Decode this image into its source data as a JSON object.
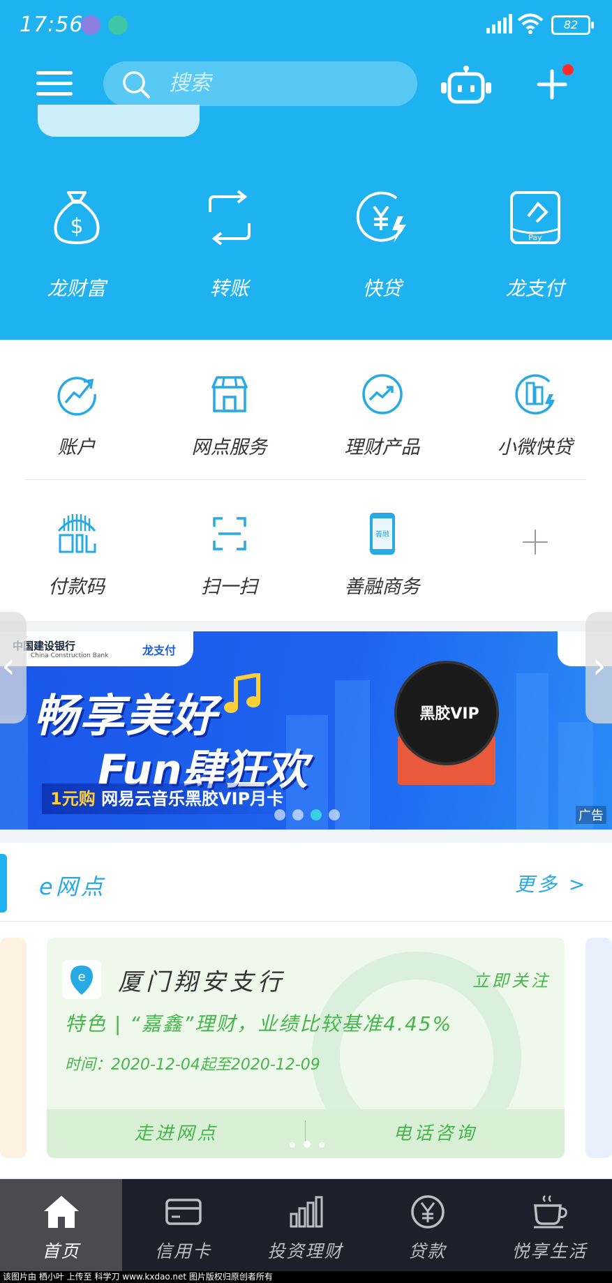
{
  "status_bar": {
    "time": "17:56",
    "battery": "82"
  },
  "header": {
    "search_placeholder": "搜索"
  },
  "quick_actions": [
    {
      "label": "龙财富",
      "icon": "money-bag-icon"
    },
    {
      "label": "转账",
      "icon": "transfer-icon"
    },
    {
      "label": "快贷",
      "icon": "quick-loan-icon"
    },
    {
      "label": "龙支付",
      "icon": "long-pay-icon"
    }
  ],
  "services": [
    {
      "label": "账户",
      "icon": "account-chart-icon"
    },
    {
      "label": "网点服务",
      "icon": "branch-store-icon"
    },
    {
      "label": "理财产品",
      "icon": "wealth-product-icon"
    },
    {
      "label": "小微快贷",
      "icon": "small-business-loan-icon"
    },
    {
      "label": "付款码",
      "icon": "payment-code-icon"
    },
    {
      "label": "扫一扫",
      "icon": "scan-icon"
    },
    {
      "label": "善融商务",
      "icon": "shanrong-commerce-icon"
    }
  ],
  "banner": {
    "brand": "中国建设银行",
    "brand_en": "China Construction Bank",
    "brand2": "龙支付",
    "headline1": "畅享美好",
    "headline2": "Fun肆狂欢",
    "offer_price": "1元购",
    "offer_text": "网易云音乐黑胶VIP月卡",
    "vinyl_label": "黑胶VIP",
    "ad_tag": "广告",
    "slide_count": 4,
    "active_slide": 3
  },
  "e_branch": {
    "title": "e网点",
    "more": "更多 >",
    "card": {
      "name": "厦门翔安支行",
      "follow": "立即关注",
      "feature": "特色  |  “嘉鑫”理财，业绩比较基准4.45%",
      "period": "时间：2020-12-04起至2020-12-09",
      "visit_button": "走进网点",
      "call_button": "电话咨询"
    }
  },
  "tabbar": [
    {
      "label": "首页",
      "icon": "home-icon",
      "active": true
    },
    {
      "label": "信用卡",
      "icon": "credit-card-icon",
      "active": false
    },
    {
      "label": "投资理财",
      "icon": "investment-chart-icon",
      "active": false
    },
    {
      "label": "贷款",
      "icon": "loan-yen-icon",
      "active": false
    },
    {
      "label": "悦享生活",
      "icon": "coffee-cup-icon",
      "active": false
    }
  ],
  "footer_note": "该图片由 栖小叶 上传至 科学刀 www.kxdao.net 图片版权归原创者所有"
}
